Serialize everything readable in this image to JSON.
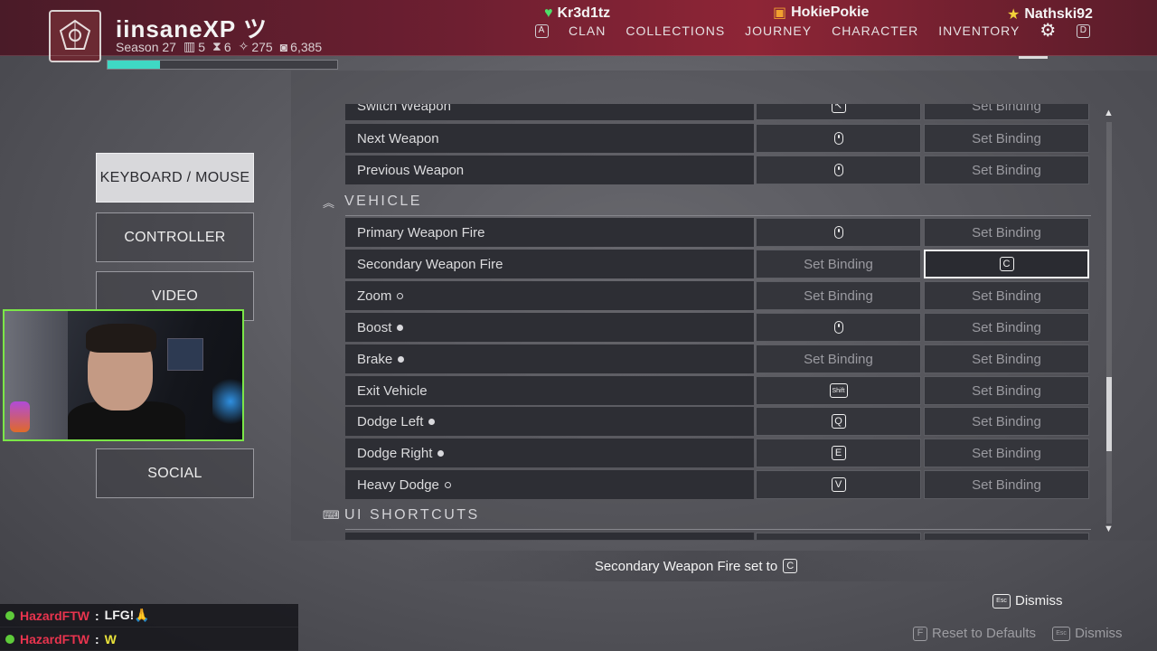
{
  "header": {
    "player_name": "iinsaneXP ツ",
    "season": "Season 27",
    "stats": [
      {
        "icon": "rank-icon",
        "value": "5"
      },
      {
        "icon": "triumph-icon",
        "value": "6"
      },
      {
        "icon": "power-icon",
        "value": "275"
      },
      {
        "icon": "glimmer-icon",
        "value": "6,385"
      }
    ],
    "xp_progress": 0.23,
    "friends": [
      {
        "name": "Kr3d1tz",
        "icon": "heart-icon",
        "color": "#4ee06a"
      },
      {
        "name": "HokiePokie",
        "icon": "gift-icon",
        "color": "#f0a030"
      },
      {
        "name": "Nathski92",
        "icon": "star-icon",
        "color": "#f2d23a"
      }
    ],
    "nav_left_key": "A",
    "nav": [
      "CLAN",
      "COLLECTIONS",
      "JOURNEY",
      "CHARACTER",
      "INVENTORY"
    ],
    "nav_right_key": "D"
  },
  "sidebar": {
    "items": [
      {
        "label": "KEYBOARD / MOUSE",
        "active": true
      },
      {
        "label": "CONTROLLER"
      },
      {
        "label": "VIDEO"
      },
      {
        "label": "SOCIAL"
      }
    ]
  },
  "bindings": {
    "rows_before": [
      {
        "action": "Switch Weapon",
        "primary": {
          "type": "key",
          "key": "↖"
        },
        "secondary": "Set Binding"
      },
      {
        "action": "Next Weapon",
        "primary": {
          "type": "mouse"
        },
        "secondary": "Set Binding"
      },
      {
        "action": "Previous Weapon",
        "primary": {
          "type": "mouse"
        },
        "secondary": "Set Binding"
      }
    ],
    "section_vehicle": "VEHICLE",
    "vehicle_rows": [
      {
        "action": "Primary Weapon Fire",
        "primary": {
          "type": "mouse"
        },
        "secondary": "Set Binding"
      },
      {
        "action": "Secondary Weapon Fire",
        "primary": "Set Binding",
        "secondary": {
          "type": "key",
          "key": "C"
        },
        "selected": true
      },
      {
        "action": "Zoom",
        "dot": "hollow",
        "primary": "Set Binding",
        "secondary": "Set Binding"
      },
      {
        "action": "Boost",
        "dot": "filled",
        "primary": {
          "type": "mouse"
        },
        "secondary": "Set Binding"
      },
      {
        "action": "Brake",
        "dot": "filled",
        "primary": "Set Binding",
        "secondary": "Set Binding"
      },
      {
        "action": "Exit Vehicle",
        "primary": {
          "type": "key",
          "key": "Shift",
          "wide": true
        },
        "secondary": "Set Binding"
      },
      {
        "action": "Dodge Left",
        "dot": "filled",
        "primary": {
          "type": "key",
          "key": "Q"
        },
        "secondary": "Set Binding"
      },
      {
        "action": "Dodge Right",
        "dot": "filled",
        "primary": {
          "type": "key",
          "key": "E"
        },
        "secondary": "Set Binding"
      },
      {
        "action": "Heavy Dodge",
        "dot": "hollow",
        "primary": {
          "type": "key",
          "key": "V"
        },
        "secondary": "Set Binding"
      }
    ],
    "section_ui": "UI SHORTCUTS"
  },
  "toast": {
    "text": "Secondary Weapon Fire set to",
    "key": "C"
  },
  "dismiss_top": {
    "key": "Esc",
    "label": "Dismiss"
  },
  "footer": [
    {
      "key": "F",
      "label": "Reset to Defaults"
    },
    {
      "key": "Esc",
      "label": "Dismiss"
    }
  ],
  "chat": [
    {
      "user": "HazardFTW",
      "message": "LFG!🙏"
    },
    {
      "user": "HazardFTW",
      "message": "W"
    }
  ]
}
